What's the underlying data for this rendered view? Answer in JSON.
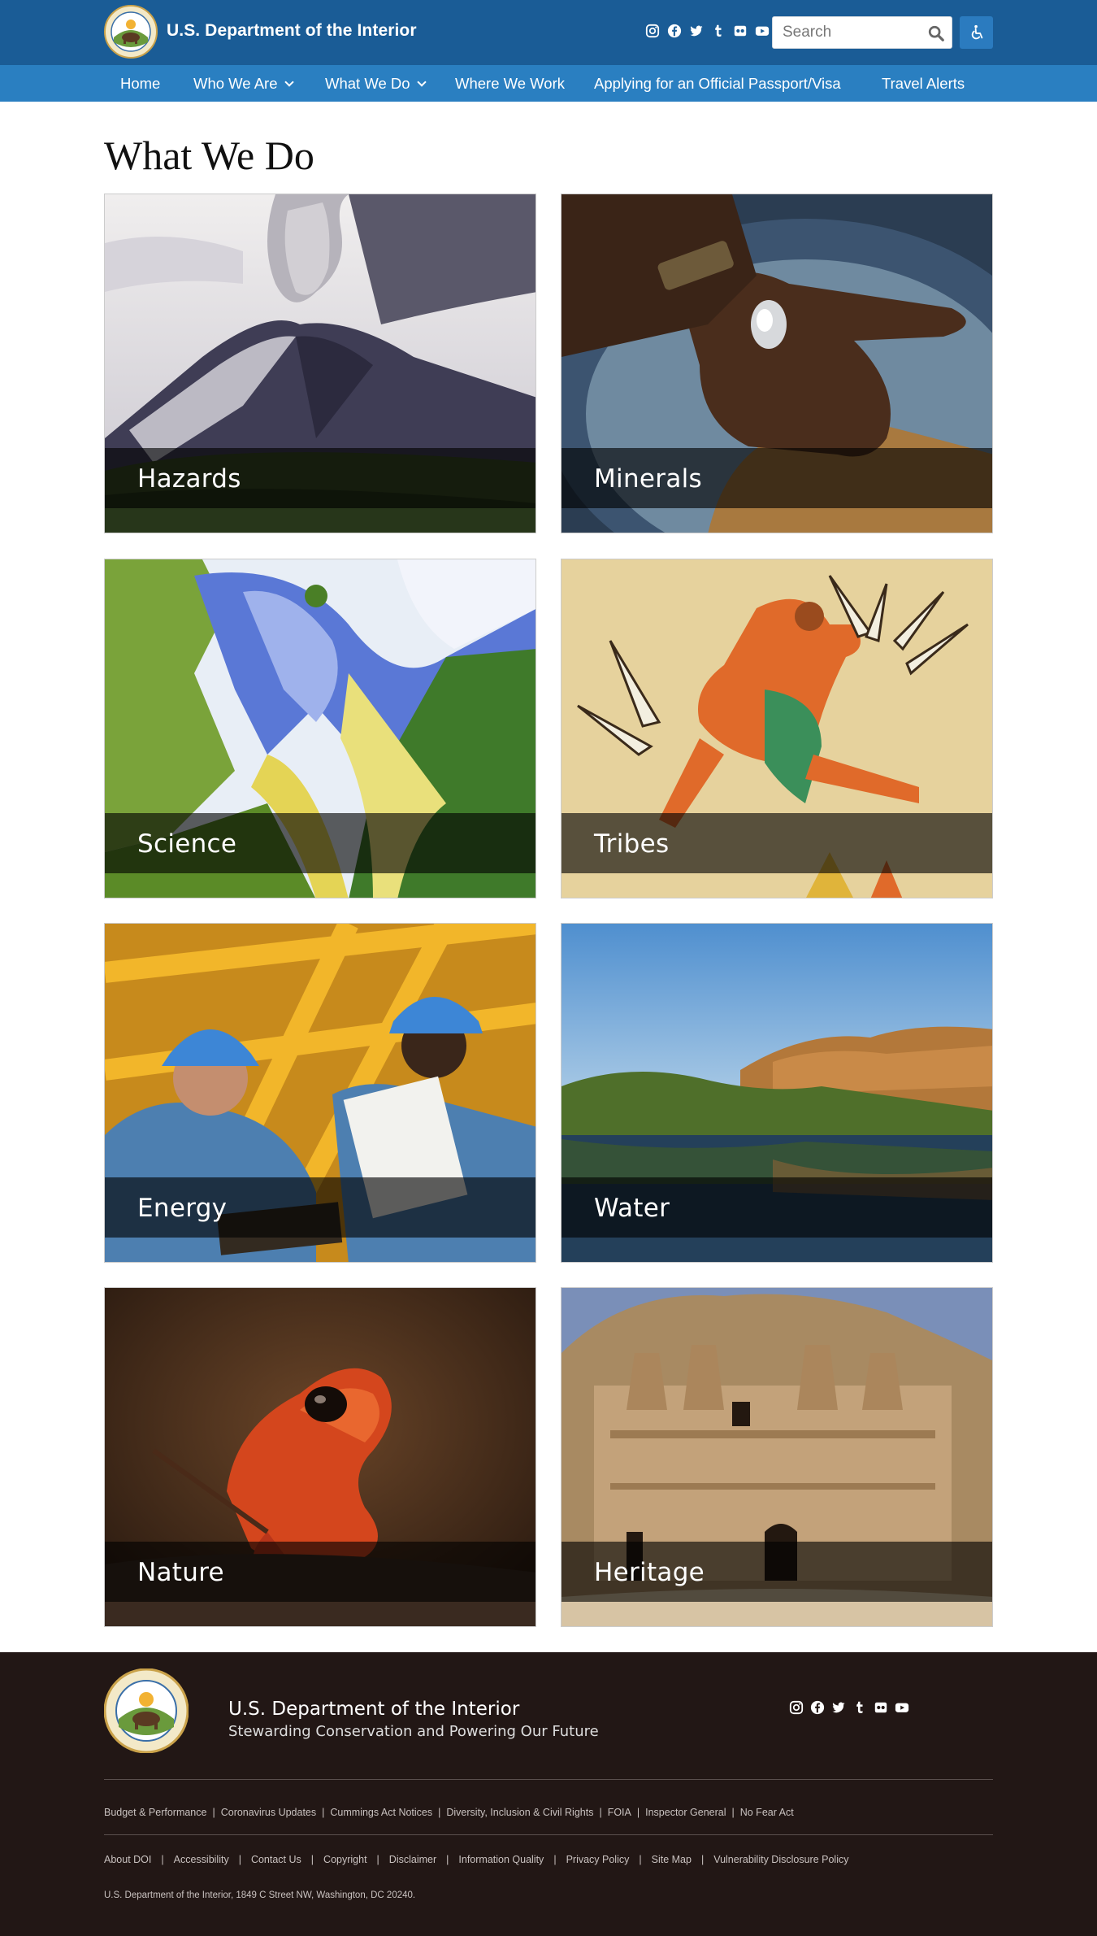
{
  "header": {
    "site_title": "U.S. Department of the Interior",
    "search_placeholder": "Search",
    "social": [
      "instagram-icon",
      "facebook-icon",
      "twitter-icon",
      "tumblr-icon",
      "flickr-icon",
      "youtube-icon"
    ],
    "accessibility_icon": "wheelchair-icon"
  },
  "nav": {
    "items": [
      {
        "label": "Home"
      },
      {
        "label": "Who We Are"
      },
      {
        "label": "What We Do"
      },
      {
        "label": "Where We Work"
      },
      {
        "label": "Applying for an Official Passport/Visa"
      },
      {
        "label": "Travel Alerts"
      }
    ]
  },
  "main": {
    "title": "What We Do",
    "cards": [
      {
        "label": "Hazards"
      },
      {
        "label": "Minerals"
      },
      {
        "label": "Science"
      },
      {
        "label": "Tribes"
      },
      {
        "label": "Energy"
      },
      {
        "label": "Water"
      },
      {
        "label": "Nature"
      },
      {
        "label": "Heritage"
      }
    ]
  },
  "footer": {
    "name": "U.S. Department of the Interior",
    "tagline": "Stewarding Conservation and Powering Our Future",
    "links_row1": [
      "Budget & Performance",
      "Coronavirus Updates",
      "Cummings Act Notices",
      "Diversity, Inclusion & Civil Rights",
      "FOIA",
      "Inspector General",
      "No Fear Act"
    ],
    "links_row2": [
      "About DOI",
      "Accessibility",
      "Contact Us",
      "Copyright",
      "Disclaimer",
      "Information Quality",
      "Privacy Policy",
      "Site Map",
      "Vulnerability Disclosure Policy"
    ],
    "address": "U.S. Department of the Interior, 1849 C Street NW, Washington, DC 20240."
  },
  "colors": {
    "header_bg": "#1a5c96",
    "nav_bg": "#2a7fc1",
    "footer_bg": "#221715"
  }
}
